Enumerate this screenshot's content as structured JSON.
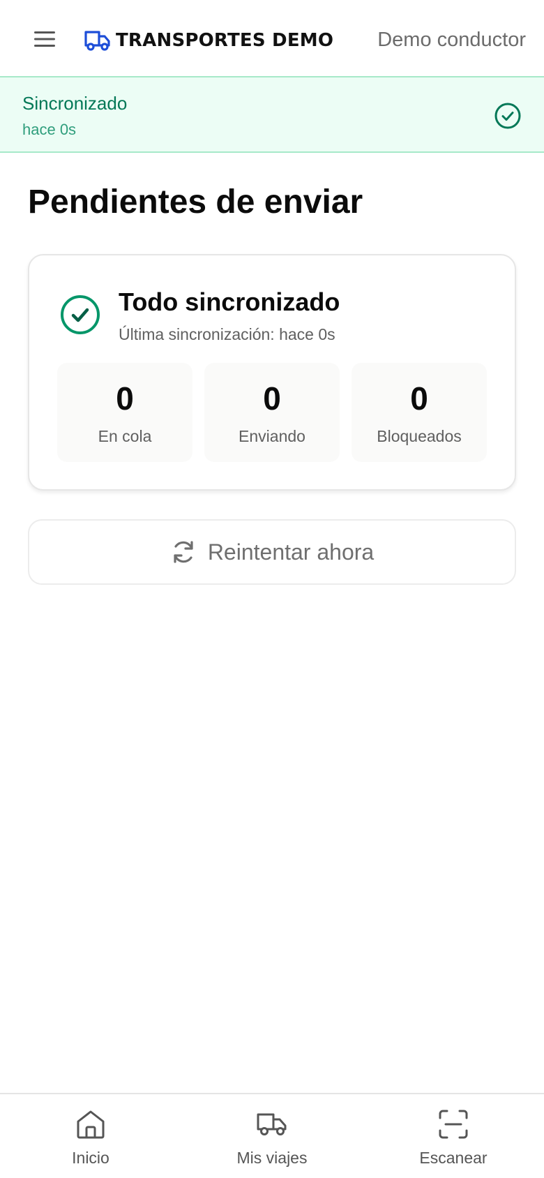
{
  "header": {
    "brand_name": "TRANSPORTES DEMO",
    "user_name": "Demo conductor",
    "brand_icon": "truck-icon",
    "menu_icon": "hamburger-menu-icon"
  },
  "sync_banner": {
    "title": "Sincronizado",
    "subtitle": "hace 0s",
    "icon": "check-circle-icon"
  },
  "page": {
    "title": "Pendientes de enviar"
  },
  "status_card": {
    "title": "Todo sincronizado",
    "subtitle": "Última sincronización: hace 0s",
    "icon": "check-circle-icon",
    "stats": [
      {
        "value": "0",
        "label": "En cola"
      },
      {
        "value": "0",
        "label": "Enviando"
      },
      {
        "value": "0",
        "label": "Bloqueados"
      }
    ]
  },
  "retry": {
    "label": "Reintentar ahora",
    "icon": "refresh-icon"
  },
  "bottom_nav": {
    "items": [
      {
        "label": "Inicio",
        "icon": "home-icon"
      },
      {
        "label": "Mis viajes",
        "icon": "truck-icon"
      },
      {
        "label": "Escanear",
        "icon": "scan-icon"
      }
    ]
  },
  "colors": {
    "brand_blue": "#1d4ed8",
    "success_green": "#059669",
    "banner_bg": "#ecfdf5",
    "banner_border": "#a7e9c9"
  }
}
